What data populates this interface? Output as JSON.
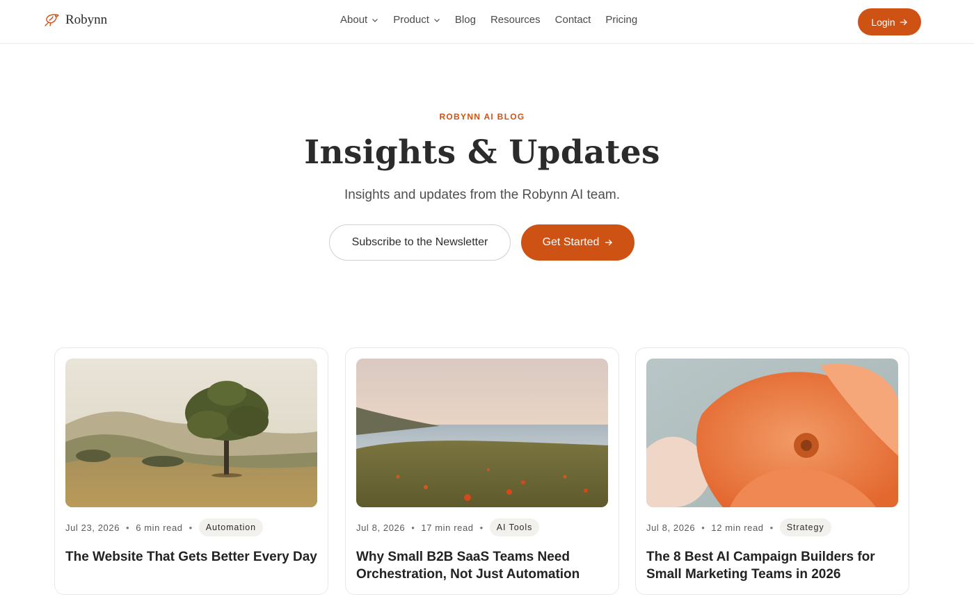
{
  "nav": {
    "brand": "Robynn",
    "items": [
      {
        "label": "About",
        "dropdown": true
      },
      {
        "label": "Product",
        "dropdown": true
      },
      {
        "label": "Blog",
        "dropdown": false
      },
      {
        "label": "Resources",
        "dropdown": false
      },
      {
        "label": "Contact",
        "dropdown": false
      },
      {
        "label": "Pricing",
        "dropdown": false
      }
    ],
    "login_label": "Login"
  },
  "hero": {
    "eyebrow": "ROBYNN AI BLOG",
    "title": "Insights & Updates",
    "subtitle": "Insights and updates from the Robynn AI team.",
    "subscribe_label": "Subscribe to the Newsletter",
    "get_started_label": "Get Started"
  },
  "posts": [
    {
      "date": "Jul 23, 2026",
      "read_time": "6 min read",
      "tag": "Automation",
      "title": "The Website That Gets Better Every Day",
      "image": "oak-tree-hills"
    },
    {
      "date": "Jul 8, 2026",
      "read_time": "17 min read",
      "tag": "AI Tools",
      "title": "Why Small B2B SaaS Teams Need Orchestration, Not Just Automation",
      "image": "coastal-poppy-meadow"
    },
    {
      "date": "Jul 8, 2026",
      "read_time": "12 min read",
      "tag": "Strategy",
      "title": "The 8 Best AI Campaign Builders for Small Marketing Teams in 2026",
      "image": "orange-poppy-closeup"
    }
  ],
  "colors": {
    "accent": "#cf5215",
    "text": "#2b2b2b",
    "tag_bg": "#f3f1ee",
    "border": "#e7e7e7"
  },
  "icons": {
    "logo": "bird-icon",
    "dropdown": "chevron-down-icon",
    "arrow": "arrow-right-icon"
  }
}
